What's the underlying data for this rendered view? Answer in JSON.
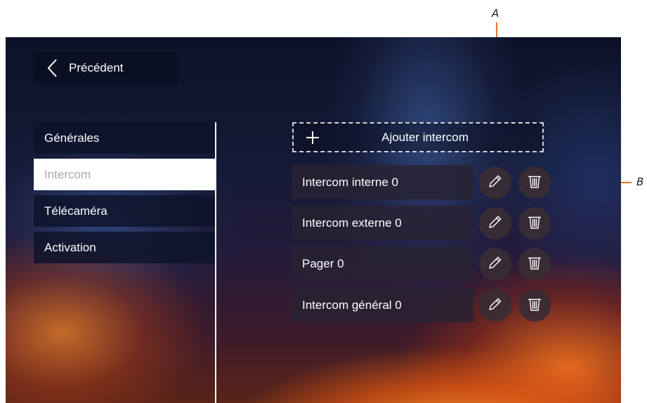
{
  "callouts": {
    "a": "A",
    "b": "B"
  },
  "colors": {
    "callout_line": "#e8742a",
    "active_item_bg": "#ffffff",
    "active_item_text": "#a8a8a8"
  },
  "header": {
    "back_label": "Précédent",
    "back_icon": "chevron-left-icon"
  },
  "menu": {
    "items": [
      {
        "label": "Générales",
        "active": false
      },
      {
        "label": "Intercom",
        "active": true
      },
      {
        "label": "Télécaméra",
        "active": false
      },
      {
        "label": "Activation",
        "active": false
      }
    ]
  },
  "intercoms": {
    "add_label": "Ajouter intercom",
    "add_icon": "plus-icon",
    "edit_icon": "pencil-icon",
    "delete_icon": "trash-icon",
    "rows": [
      {
        "name": "Intercom interne 0"
      },
      {
        "name": "Intercom externe 0"
      },
      {
        "name": "Pager 0"
      },
      {
        "name": "Intercom général 0"
      }
    ]
  }
}
